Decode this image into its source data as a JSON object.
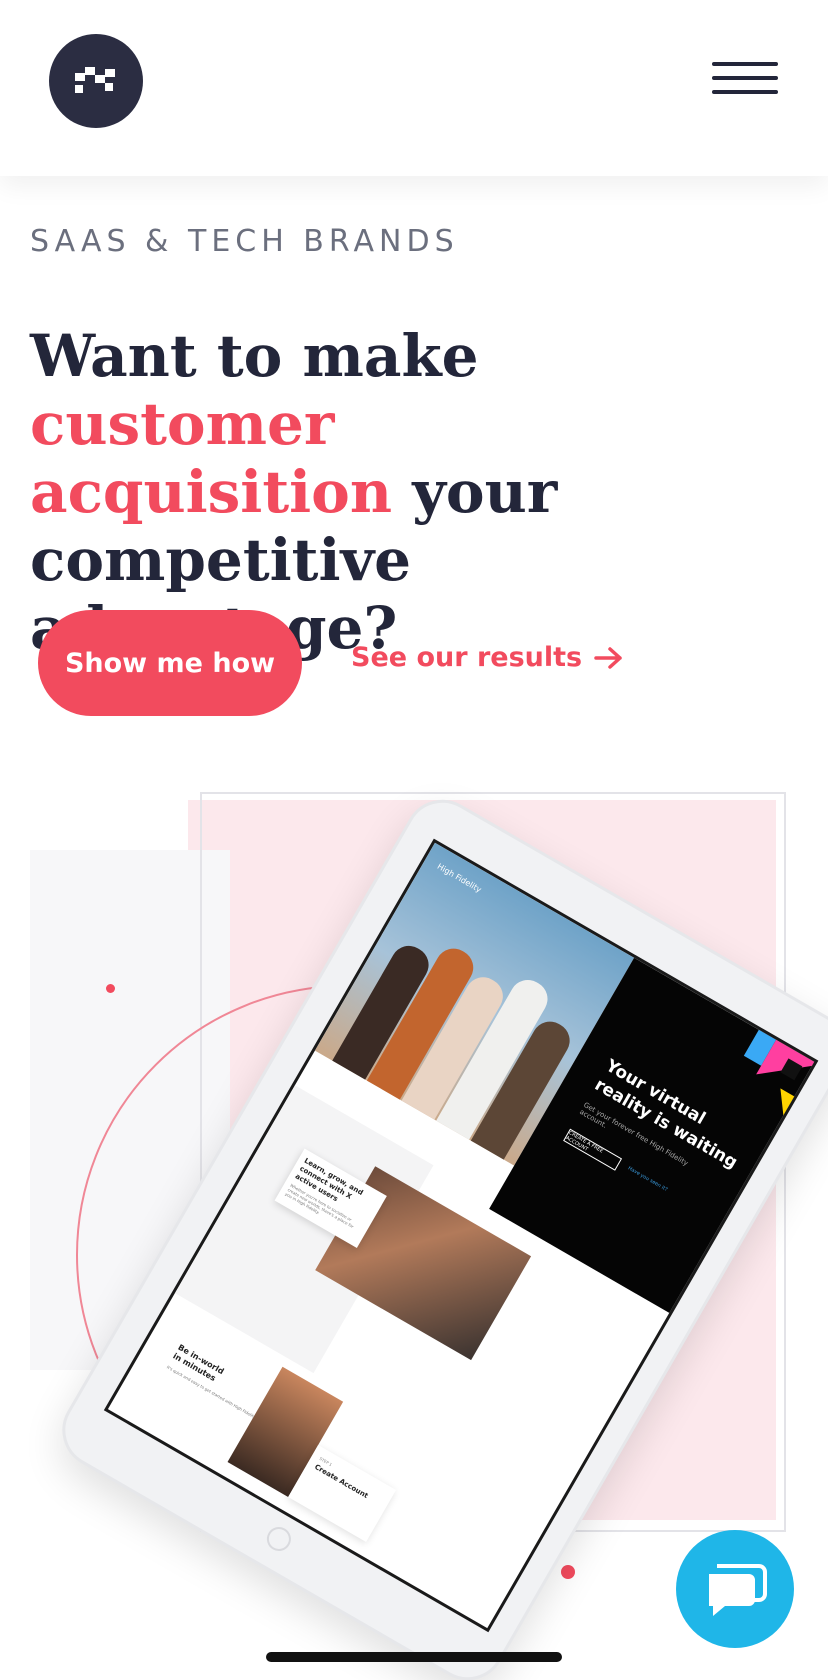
{
  "header": {
    "logo_icon": "brand-mark-icon",
    "menu_icon": "hamburger-menu-icon"
  },
  "hero": {
    "eyebrow": "SAAS & TECH BRANDS",
    "headline_part1": "Want to make ",
    "headline_accent1": "customer",
    "headline_accent2": "acquisition",
    "headline_part2": " your",
    "headline_part3": "competitive advantage?",
    "primary_cta": "Show me how",
    "secondary_cta": "See our results",
    "secondary_icon": "arrow-right-icon"
  },
  "tablet_mock": {
    "brand": "High Fidelity",
    "hero_title_line1": "Your virtual",
    "hero_title_line2": "reality is waiting",
    "hero_sub": "Get your forever free High Fidelity account.",
    "hero_button": "CREATE A FREE ACCOUNT",
    "hero_link": "Have you seen it?",
    "card_title": "Learn, grow, and connect with X active users",
    "card_body": "Whether you're here to socialize or create new worlds, there's a place for you in High Fidelity.",
    "bottom_title_line1": "Be in-world",
    "bottom_title_line2": "in minutes",
    "bottom_body": "It's quick and easy to get started with High Fidelity.",
    "step_label": "STEP 1",
    "step_title": "Create Account"
  },
  "colors": {
    "accent": "#f24b5e",
    "dark": "#23263a",
    "chat": "#1fb6e8"
  },
  "chat": {
    "icon": "chat-bubble-icon"
  }
}
